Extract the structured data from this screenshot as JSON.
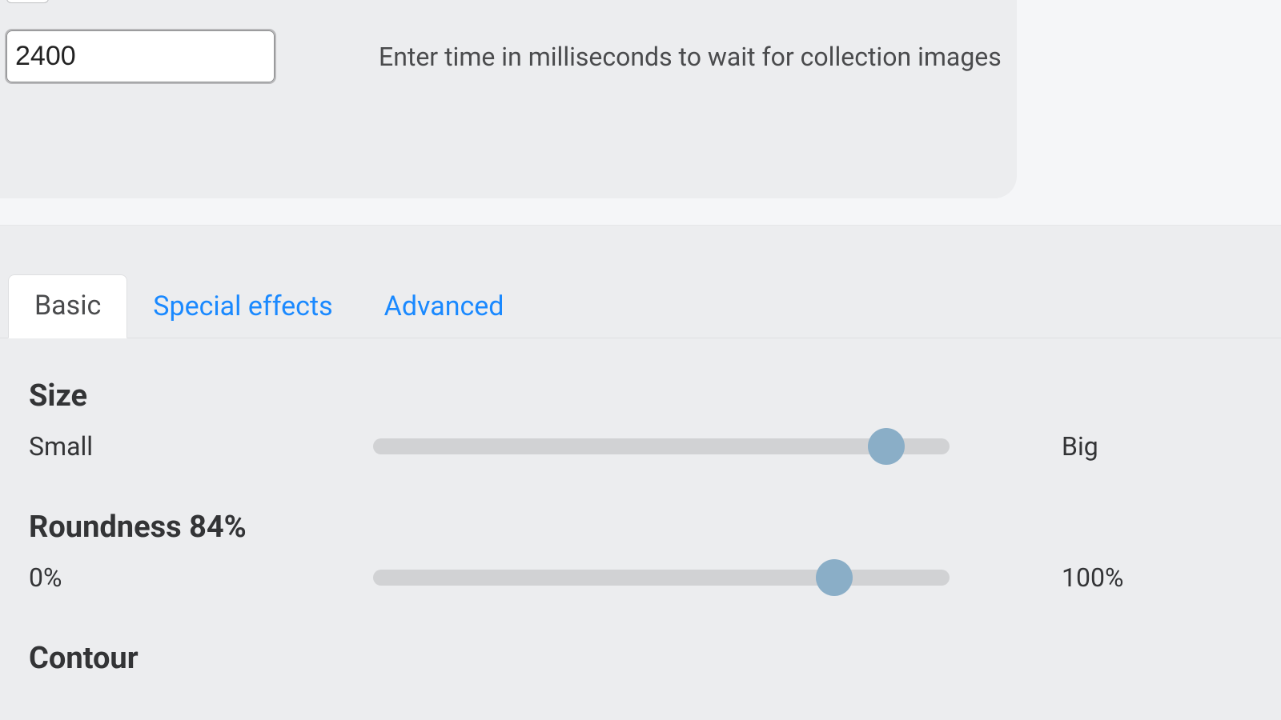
{
  "upper": {
    "time_value": "2400",
    "time_desc": "Enter time in milliseconds to wait for collection images"
  },
  "tabs": {
    "basic": "Basic",
    "special_effects": "Special effects",
    "advanced": "Advanced"
  },
  "size": {
    "heading": "Size",
    "min_label": "Small",
    "max_label": "Big",
    "value_pct": 89
  },
  "roundness": {
    "heading": "Roundness 84%",
    "min_label": "0%",
    "max_label": "100%",
    "value_pct": 80
  },
  "contour": {
    "heading": "Contour"
  }
}
